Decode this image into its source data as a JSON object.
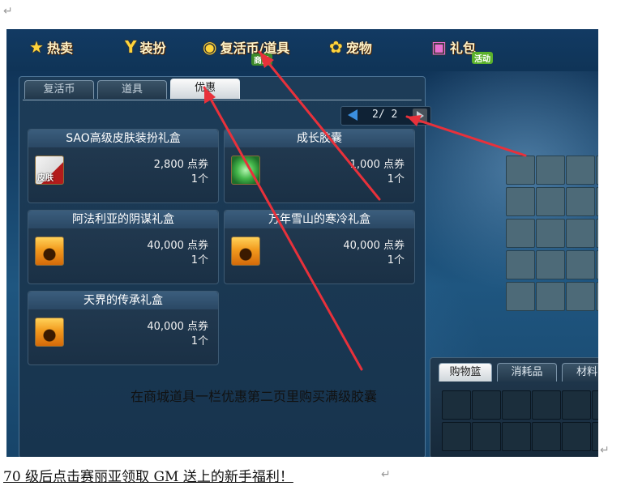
{
  "topnav": {
    "hot": "热卖",
    "dress": "装扮",
    "revive": "复活币/道具",
    "revive_badge": "商品",
    "pet": "宠物",
    "gift": "礼包",
    "gift_badge": "活动"
  },
  "tabs": [
    "复活币",
    "道具",
    "优惠"
  ],
  "active_tab": "优惠",
  "pager": {
    "text": "2/ 2"
  },
  "items": [
    {
      "name": "SAO高级皮肤装扮礼盒",
      "price": "2,800 点券",
      "qty": "1个",
      "icon": "skin-gift-icon",
      "icon_text": "皮肤"
    },
    {
      "name": "成长胶囊",
      "price": "1,000 点券",
      "qty": "1个",
      "icon": "capsule-icon"
    },
    {
      "name": "阿法利亚的阴谋礼盒",
      "price": "40,000 点券",
      "qty": "1个",
      "icon": "gift-box-icon"
    },
    {
      "name": "万年雪山的寒冷礼盒",
      "price": "40,000 点券",
      "qty": "1个",
      "icon": "gift-box-icon"
    },
    {
      "name": "天界的传承礼盒",
      "price": "40,000 点券",
      "qty": "1个",
      "icon": "gift-box-icon"
    }
  ],
  "cart_tabs": [
    "购物篮",
    "消耗品",
    "材料"
  ],
  "caption": "在商城道具一栏优惠第二页里购买满级胶囊",
  "footer": "70 级后点击赛丽亚领取 GM 送上的新手福利！",
  "colors": {
    "annotation_arrow": "#e8313b",
    "panel_bg": "#1d3c58",
    "price_text": "#f2f2f2"
  }
}
